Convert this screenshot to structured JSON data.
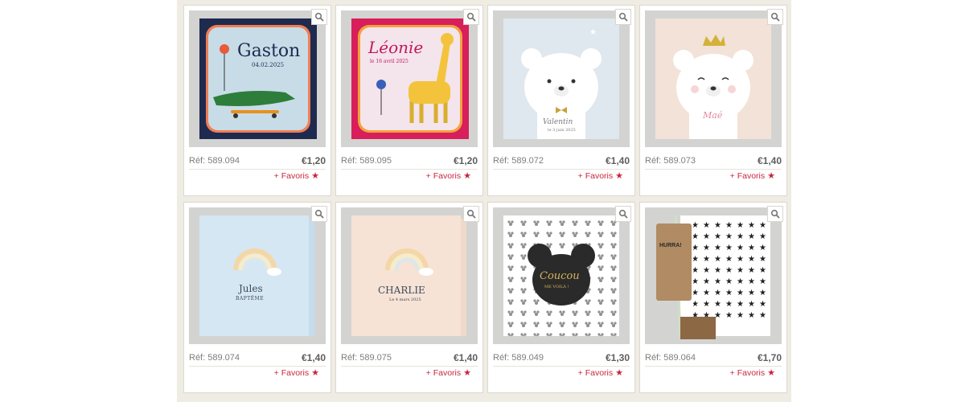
{
  "favoris_label": "+ Favoris",
  "colors": {
    "favoris": "#c8273e",
    "page_background": "#efece4"
  },
  "cards": [
    {
      "ref": "Réf: 589.094",
      "price": "€1,20",
      "name": "Gaston",
      "date": "04.02.2025"
    },
    {
      "ref": "Réf: 589.095",
      "price": "€1,20",
      "name": "Léonie",
      "date": "le 16 avril 2025"
    },
    {
      "ref": "Réf: 589.072",
      "price": "€1,40",
      "name": "Valentin",
      "date": "le 3 juin 2025"
    },
    {
      "ref": "Réf: 589.073",
      "price": "€1,40",
      "name": "Maé"
    },
    {
      "ref": "Réf: 589.074",
      "price": "€1,40",
      "name": "Jules",
      "subtitle": "BAPTÊME"
    },
    {
      "ref": "Réf: 589.075",
      "price": "€1,40",
      "name": "CHARLIE",
      "date": "Le 4 mars 2025"
    },
    {
      "ref": "Réf: 589.049",
      "price": "€1,30",
      "name": "Coucou",
      "subtitle": "ME VOILÀ !"
    },
    {
      "ref": "Réf: 589.064",
      "price": "€1,70",
      "name": "HURRA!"
    }
  ]
}
